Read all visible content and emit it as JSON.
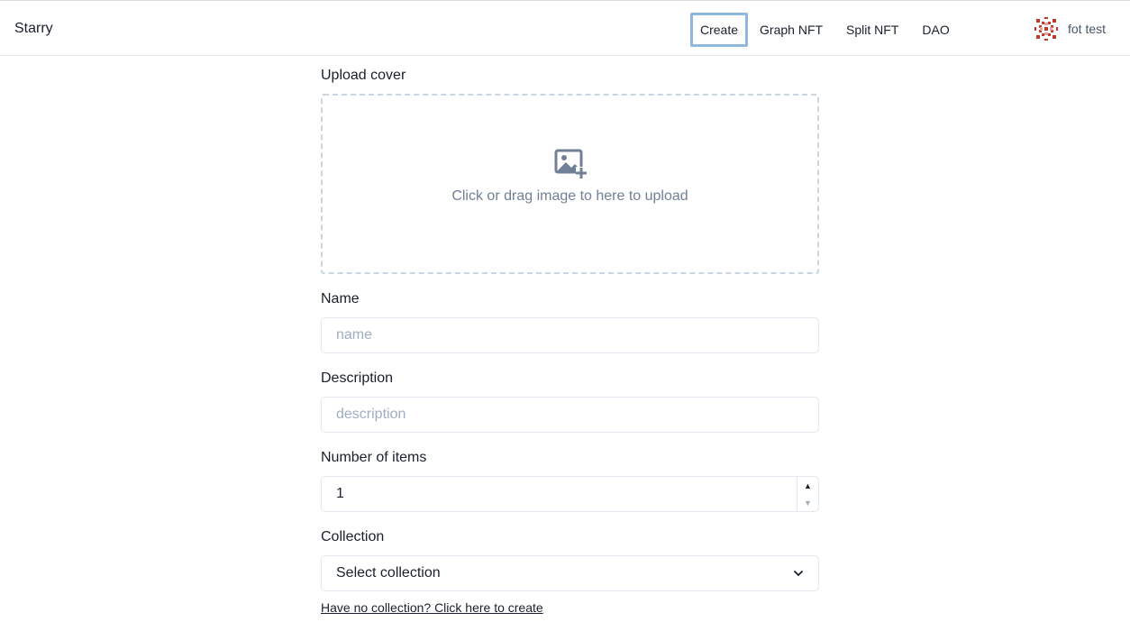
{
  "header": {
    "brand": "Starry",
    "nav": [
      {
        "label": "Create",
        "active": true
      },
      {
        "label": "Graph NFT"
      },
      {
        "label": "Split NFT"
      },
      {
        "label": "DAO"
      }
    ],
    "user": {
      "name": "fot test",
      "avatar_icon": "identicon-avatar",
      "avatar_color": "#c0392b"
    }
  },
  "form": {
    "cover": {
      "label": "Upload cover",
      "icon": "image-add-icon",
      "hint": "Click or drag image to here to upload"
    },
    "name": {
      "label": "Name",
      "placeholder": "name",
      "value": ""
    },
    "description": {
      "label": "Description",
      "placeholder": "description",
      "value": ""
    },
    "items": {
      "label": "Number of items",
      "value": "1"
    },
    "collection": {
      "label": "Collection",
      "selected": "Select collection",
      "create_link": "Have no collection? Click here to create"
    }
  },
  "colors": {
    "active_nav_border": "#90b8dc",
    "muted_text": "#718096",
    "border": "#e2e8f0"
  }
}
